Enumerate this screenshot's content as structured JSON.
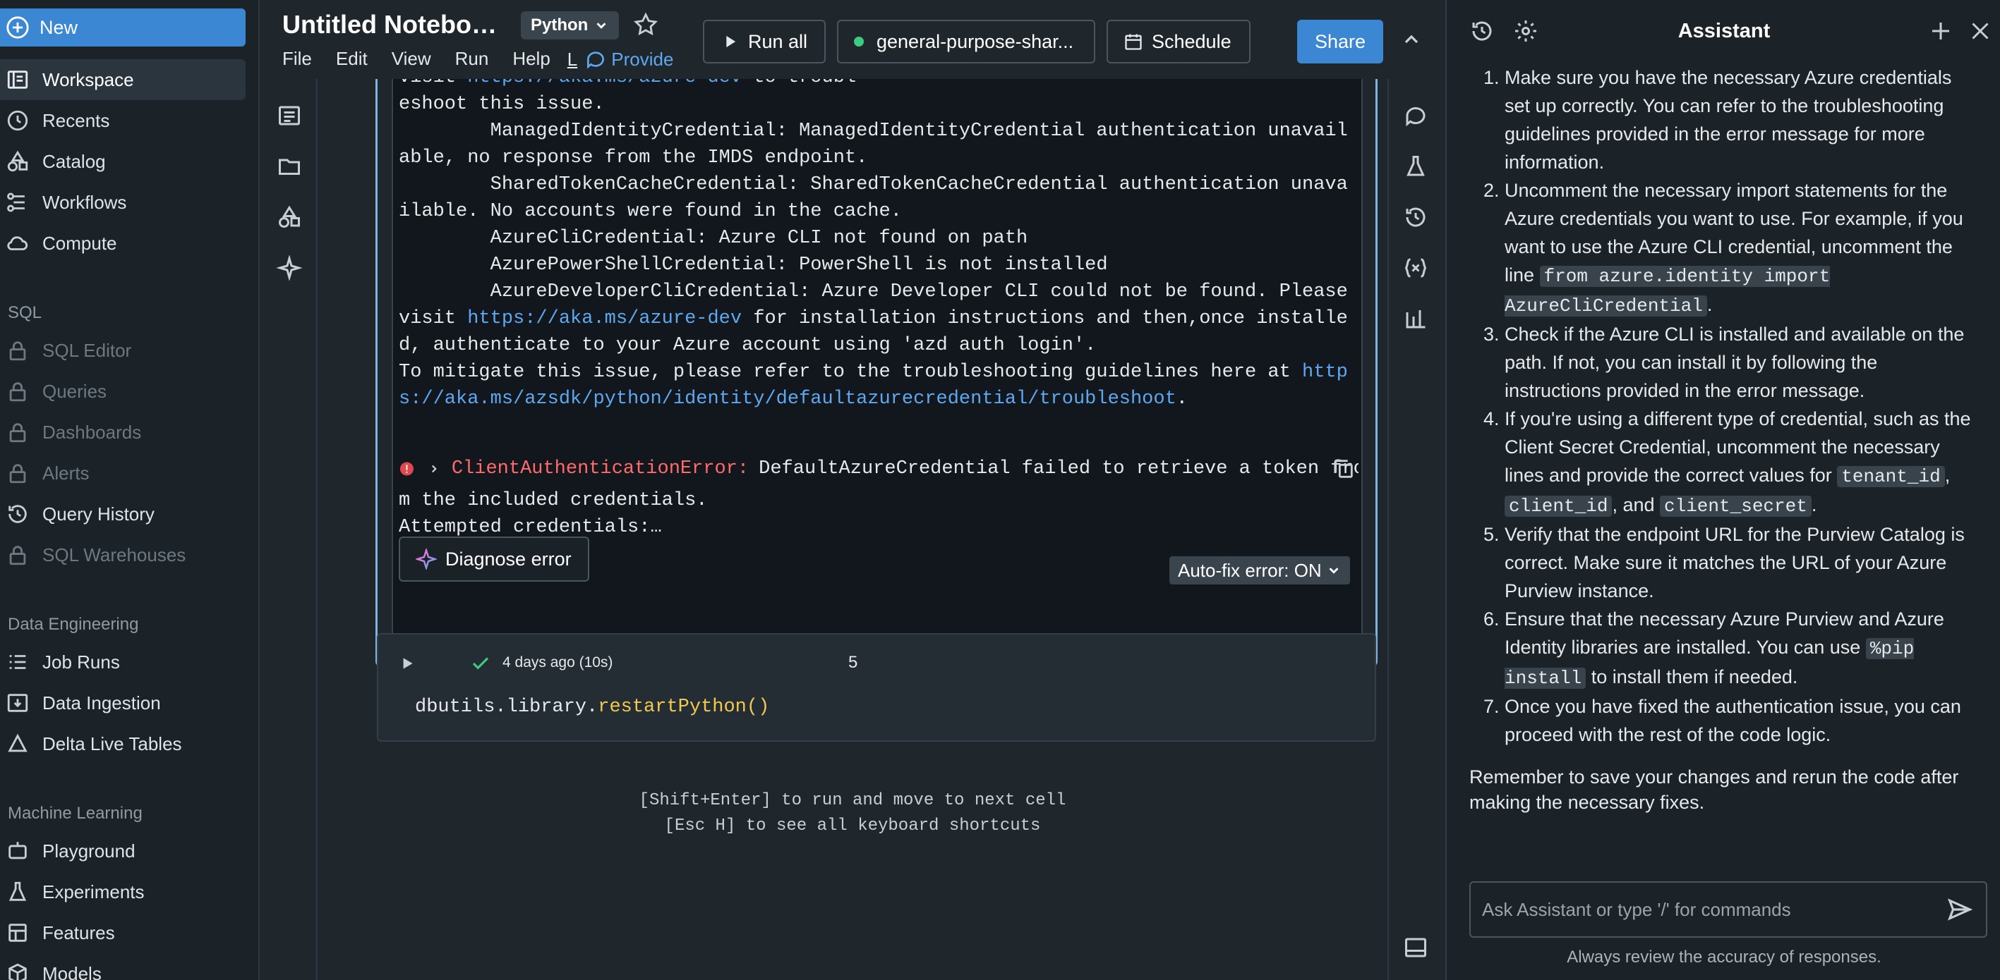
{
  "sidebar": {
    "new_label": "New",
    "items": [
      {
        "label": "Workspace"
      },
      {
        "label": "Recents"
      },
      {
        "label": "Catalog"
      },
      {
        "label": "Workflows"
      },
      {
        "label": "Compute"
      }
    ],
    "sql_head": "SQL",
    "sql_items": [
      {
        "label": "SQL Editor"
      },
      {
        "label": "Queries"
      },
      {
        "label": "Dashboards"
      },
      {
        "label": "Alerts"
      },
      {
        "label": "Query History"
      },
      {
        "label": "SQL Warehouses"
      }
    ],
    "de_head": "Data Engineering",
    "de_items": [
      {
        "label": "Job Runs"
      },
      {
        "label": "Data Ingestion"
      },
      {
        "label": "Delta Live Tables"
      }
    ],
    "ml_head": "Machine Learning",
    "ml_items": [
      {
        "label": "Playground"
      },
      {
        "label": "Experiments"
      },
      {
        "label": "Features"
      },
      {
        "label": "Models"
      }
    ]
  },
  "header": {
    "title": "Untitled Noteboo...",
    "language": "Python",
    "menu": [
      "File",
      "Edit",
      "View",
      "Run",
      "Help"
    ],
    "last_edit_letter": "L",
    "provide_feedback": "Provide",
    "run_all": "Run all",
    "cluster": "general-purpose-shar...",
    "schedule": "Schedule",
    "share": "Share"
  },
  "error_cell": {
    "lines": [
      "eshoot this issue.",
      "        ManagedIdentityCredential: ManagedIdentityCredential authentication unavailable, no response from the IMDS endpoint.",
      "        SharedTokenCacheCredential: SharedTokenCacheCredential authentication unavailable. No accounts were found in the cache.",
      "        AzureCliCredential: Azure CLI not found on path",
      "        AzurePowerShellCredential: PowerShell is not installed"
    ],
    "top_line_prefix": "visit ",
    "top_line_link": "https://aka.ms/azure-dev",
    "top_line_suffix": " to troubl",
    "dev_cli_line": "        AzureDeveloperCliCredential: Azure Developer CLI could not be found. Please visit ",
    "dev_cli_link": "https://aka.ms/azure-dev",
    "dev_cli_after": " for installation instructions and then,once installed, authenticate to your Azure account using 'azd auth login'.",
    "mitigate": "To mitigate this issue, please refer to the troubleshooting guidelines here at ",
    "mitigate_link": "https://aka.ms/azsdk/python/identity/defaultazurecredential/troubleshoot",
    "mitigate_end": ".",
    "error_type": "ClientAuthenticationError:",
    "error_msg": "DefaultAzureCredential failed to retrieve a token fro",
    "error_cont": "m the included credentials.",
    "attempted": "Attempted credentials:…",
    "diagnose": "Diagnose error",
    "autofix": "Auto-fix error: ON"
  },
  "cell2": {
    "meta": "4 days ago (10s)",
    "number": "5",
    "code_obj": "dbutils.library.",
    "code_fn": "restartPython()"
  },
  "hints": {
    "line1": "[Shift+Enter] to run and move to next cell",
    "line2": "[Esc H] to see all keyboard shortcuts"
  },
  "assistant": {
    "title": "Assistant",
    "steps": {
      "s1": "Make sure you have the necessary Azure credentials set up correctly. You can refer to the troubleshooting guidelines provided in the error message for more information.",
      "s2a": "Uncomment the necessary import statements for the Azure credentials you want to use. For example, if you want to use the Azure CLI credential, uncomment the line ",
      "s2code": "from azure.identity import AzureCliCredential",
      "s2b": ".",
      "s3": "Check if the Azure CLI is installed and available on the path. If not, you can install it by following the instructions provided in the error message.",
      "s4a": "If you're using a different type of credential, such as the Client Secret Credential, uncomment the necessary lines and provide the correct values for ",
      "s4c1": "tenant_id",
      "s4sep1": ", ",
      "s4c2": "client_id",
      "s4sep2": ", and ",
      "s4c3": "client_secret",
      "s4end": ".",
      "s5": "Verify that the endpoint URL for the Purview Catalog is correct. Make sure it matches the URL of your Azure Purview instance.",
      "s6a": "Ensure that the necessary Azure Purview and Azure Identity libraries are installed. You can use ",
      "s6code": "%pip install",
      "s6b": " to install them if needed.",
      "s7": "Once you have fixed the authentication issue, you can proceed with the rest of the code logic."
    },
    "remember": "Remember to save your changes and rerun the code after making the necessary fixes.",
    "input_placeholder": "Ask Assistant or type '/' for commands",
    "footer": "Always review the accuracy of responses."
  },
  "colors": {
    "accent": "#3b87d4",
    "error": "#ff6b6b",
    "success": "#3ccb7f",
    "link": "#5fa8f0"
  }
}
